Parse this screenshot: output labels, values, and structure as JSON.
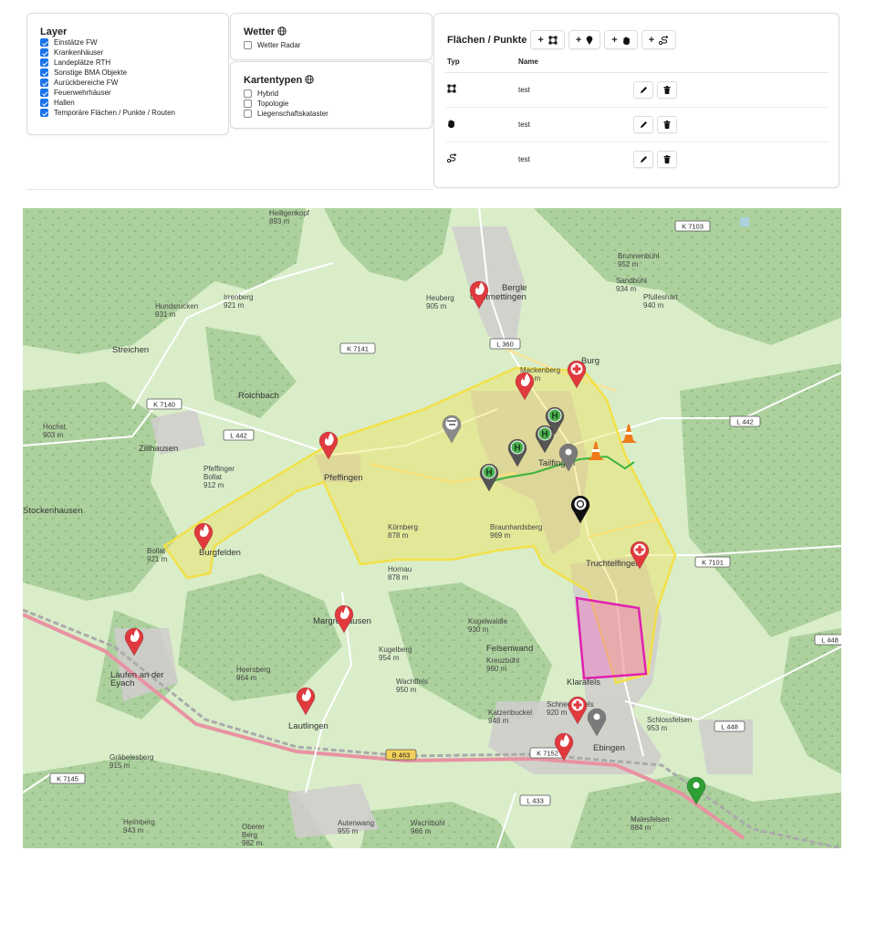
{
  "layer": {
    "title": "Layer",
    "items": [
      {
        "label": "Einstätze FW",
        "checked": true
      },
      {
        "label": "Krankenhäuser",
        "checked": true
      },
      {
        "label": "Landeplätze RTH",
        "checked": true
      },
      {
        "label": "Sonstige BMA Objekte",
        "checked": true
      },
      {
        "label": "Aurückbereiche FW",
        "checked": true
      },
      {
        "label": "Feuerwehrhäuser",
        "checked": true
      },
      {
        "label": "Hallen",
        "checked": true
      },
      {
        "label": "Temporäre Flächen / Punkte / Routen",
        "checked": true
      }
    ]
  },
  "wetter": {
    "title": "Wetter",
    "items": [
      {
        "label": "Wetter Radar",
        "checked": false
      }
    ]
  },
  "kartentypen": {
    "title": "Kartentypen",
    "items": [
      {
        "label": "Hybrid",
        "checked": false
      },
      {
        "label": "Topologie",
        "checked": false
      },
      {
        "label": "Liegenschaftskataster",
        "checked": false
      }
    ]
  },
  "flaechen": {
    "title": "Flächen / Punkte",
    "add_buttons": [
      {
        "label": "+",
        "icon": "polygon-icon"
      },
      {
        "label": "+",
        "icon": "marker-icon"
      },
      {
        "label": "+",
        "icon": "hand-icon"
      },
      {
        "label": "+",
        "icon": "route-icon"
      }
    ],
    "columns": [
      "Typ",
      "Name"
    ],
    "rows": [
      {
        "type_icon": "polygon-icon",
        "name": "test"
      },
      {
        "type_icon": "hand-icon",
        "name": "test"
      },
      {
        "type_icon": "route-icon",
        "name": "test"
      }
    ]
  },
  "map": {
    "places": [
      {
        "name": "Onstmettingen"
      },
      {
        "name": "Bergle"
      },
      {
        "name": "Heuberg\n905 m"
      },
      {
        "name": "Streichen"
      },
      {
        "name": "Hundsrucken\n931 m"
      },
      {
        "name": "Irrenberg\n921 m"
      },
      {
        "name": "Zillhausen"
      },
      {
        "name": "Hochst\n903 m"
      },
      {
        "name": "Pfeffingen"
      },
      {
        "name": "Pfeffinger\nBollat\n912 m"
      },
      {
        "name": "Stockenhausen"
      },
      {
        "name": "Burgfelden"
      },
      {
        "name": "Bollat\n921 m"
      },
      {
        "name": "Tailfingen"
      },
      {
        "name": "Truchtelfingen"
      },
      {
        "name": "Margrethausen"
      },
      {
        "name": "Laufen an der\nEyach"
      },
      {
        "name": "Lautlingen"
      },
      {
        "name": "Ebingen"
      },
      {
        "name": "Körnberg\n878 m"
      },
      {
        "name": "Hornau\n878 m"
      },
      {
        "name": "Braunhardsberg\n969 m"
      },
      {
        "name": "Brunnenbühl\n952 m"
      },
      {
        "name": "Sandbühl\n934 m"
      },
      {
        "name": "Pfulleshart\n940 m"
      },
      {
        "name": "Kugelwaldle\n930 m"
      },
      {
        "name": "Felsenwand"
      },
      {
        "name": "Kreuzbühl\n960 m"
      },
      {
        "name": "Kugelberg\n954 m"
      },
      {
        "name": "Heersberg\n964 m"
      },
      {
        "name": "Wachtfels\n950 m"
      },
      {
        "name": "Klarafels"
      },
      {
        "name": "Schneckesfels\n920 m"
      },
      {
        "name": "Katzenbuckel\n948 m"
      },
      {
        "name": "Schlossfelsen\n953 m"
      },
      {
        "name": "Gräbelesberg\n915 m"
      },
      {
        "name": "Heimberg\n943 m"
      },
      {
        "name": "Oberer\nBerg\n982 m"
      },
      {
        "name": "Autenwang\n955 m"
      },
      {
        "name": "Wachtbühl\n966 m"
      },
      {
        "name": "Malesfelsen\n884 m"
      },
      {
        "name": "Heiligenkopf\n893 m"
      },
      {
        "name": "Mackenberg\n944 m"
      },
      {
        "name": "Burg"
      },
      {
        "name": "Rolchbach"
      }
    ],
    "roads": [
      "K 7103",
      "K 7141",
      "L 360",
      "K 7140",
      "L 442",
      "L 442",
      "K 7101",
      "L 448",
      "L 448",
      "K 7152",
      "B 463",
      "L 433",
      "K 7145"
    ]
  },
  "colors": {
    "accent": "#1a73e8",
    "area_yellow": "#f2e04a",
    "area_pink": "#e020b0",
    "route_green": "#3cb53c",
    "marker_red": "#e0393e",
    "marker_green": "#2f7d32",
    "marker_gray": "#7a7a7a"
  }
}
